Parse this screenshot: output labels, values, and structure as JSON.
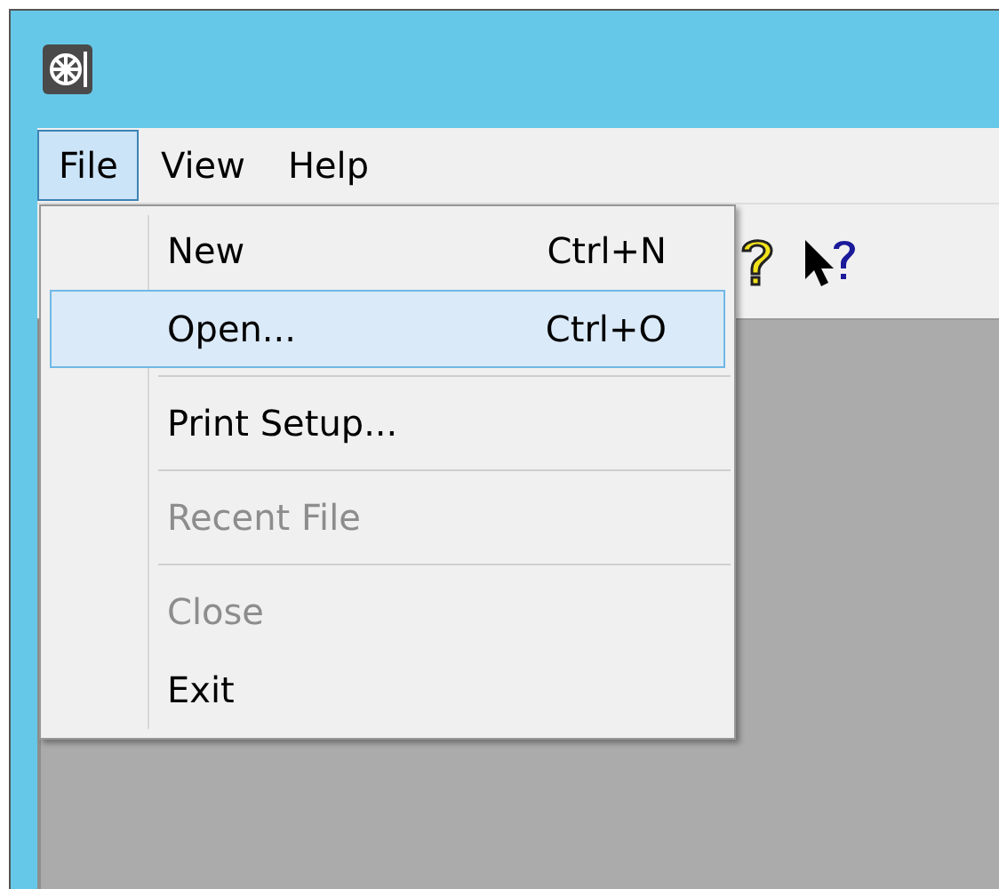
{
  "menu_bar": [
    {
      "label": "File",
      "selected": true
    },
    {
      "label": "View",
      "selected": false
    },
    {
      "label": "Help",
      "selected": false
    }
  ],
  "file_menu": [
    {
      "label": "New",
      "shortcut": "Ctrl+N",
      "selected": false,
      "disabled": false,
      "separator_after": false
    },
    {
      "label": "Open...",
      "shortcut": "Ctrl+O",
      "selected": true,
      "disabled": false,
      "separator_after": true
    },
    {
      "label": "Print Setup...",
      "selected": false,
      "disabled": false,
      "separator_after": true
    },
    {
      "label": "Recent File",
      "selected": false,
      "disabled": true,
      "separator_after": true
    },
    {
      "label": "Close",
      "selected": false,
      "disabled": true,
      "separator_after": false
    },
    {
      "label": "Exit",
      "selected": false,
      "disabled": false,
      "separator_after": false
    }
  ]
}
